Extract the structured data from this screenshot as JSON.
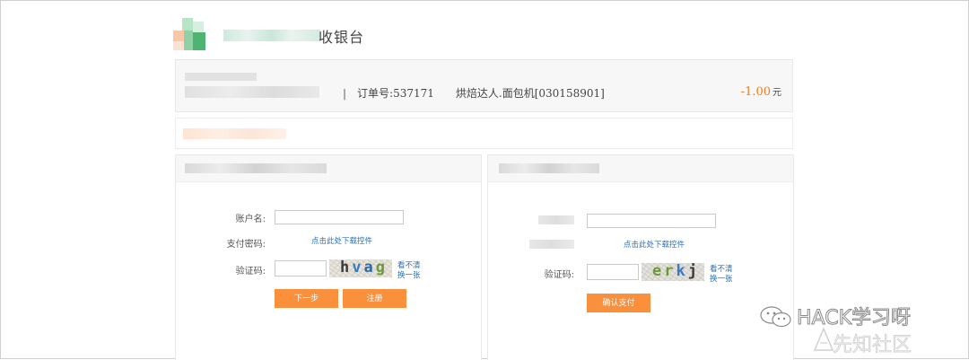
{
  "header": {
    "title": "收银台"
  },
  "order": {
    "separator": "|",
    "order_no_label": "订单号:",
    "order_no": "537171",
    "product": "烘焙达人.面包机[030158901]",
    "amount": "-1.00",
    "currency_unit": "元"
  },
  "left_panel": {
    "account_label": "账户名:",
    "account_value": "",
    "password_label": "支付密码:",
    "download_control_link": "点击此处下载控件",
    "captcha_label": "验证码:",
    "captcha_value": "",
    "captcha_chars": [
      "h",
      "v",
      "a",
      "g"
    ],
    "refresh_line1": "看不清",
    "refresh_line2": "换一张",
    "next_button": "下一步",
    "register_button": "注册"
  },
  "right_panel": {
    "download_control_link": "点击此处下载控件",
    "captcha_label": "验证码:",
    "captcha_value": "",
    "captcha_chars": [
      "e",
      "r",
      "k",
      "j"
    ],
    "refresh_line1": "看不清",
    "refresh_line2": "换一张",
    "confirm_button": "确认支付"
  },
  "watermarks": {
    "wechat": "HACK学习呀",
    "xianzhi": "先知社区"
  },
  "colors": {
    "accent_orange": "#fa8f3c",
    "amount_orange": "#f07c1f",
    "link_blue": "#2b6fb5"
  }
}
